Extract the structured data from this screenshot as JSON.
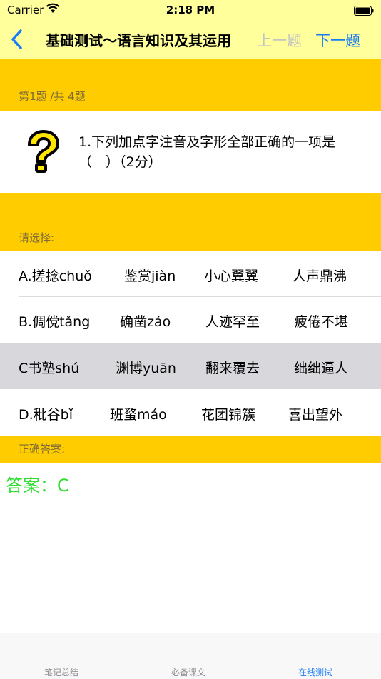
{
  "status": {
    "carrier": "Carrier",
    "time": "2:18 PM"
  },
  "nav": {
    "title": "基础测试～语言知识及其运用",
    "prev_label": "上一题",
    "next_label": "下一题"
  },
  "question": {
    "index_label": "第1题 /共 4题",
    "text": "1.下列加点字注音及字形全部正确的一项是（　）（2分）"
  },
  "choose_label": "请选择:",
  "options": [
    {
      "cells": [
        "A.搓捻chuǒ",
        "鉴赏jiàn",
        "小心翼翼",
        "人声鼎沸"
      ],
      "selected": false
    },
    {
      "cells": [
        "B.倜傥tǎng",
        "确凿záo",
        "人迹罕至",
        "疲倦不堪"
      ],
      "selected": false
    },
    {
      "cells": [
        "C书塾shú",
        "渊博yuān",
        "翻来覆去",
        "绌绌逼人"
      ],
      "selected": true
    },
    {
      "cells": [
        "D.秕谷bǐ",
        "班蝥máo",
        "花团锦簇",
        "喜出望外"
      ],
      "selected": false
    }
  ],
  "answer": {
    "band_label": "正确答案:",
    "text": "答案：C"
  },
  "tabs": [
    {
      "label": "笔记总结",
      "active": false
    },
    {
      "label": "必备课文",
      "active": false
    },
    {
      "label": "在线测试",
      "active": true
    }
  ],
  "colors": {
    "accent": "#1a7cf5",
    "band": "#ffcc00",
    "nav_bg": "#ffff9c",
    "answer": "#33dd33"
  },
  "icons": {
    "nav_back": "chevron-left-icon",
    "question": "question-mark-icon"
  }
}
